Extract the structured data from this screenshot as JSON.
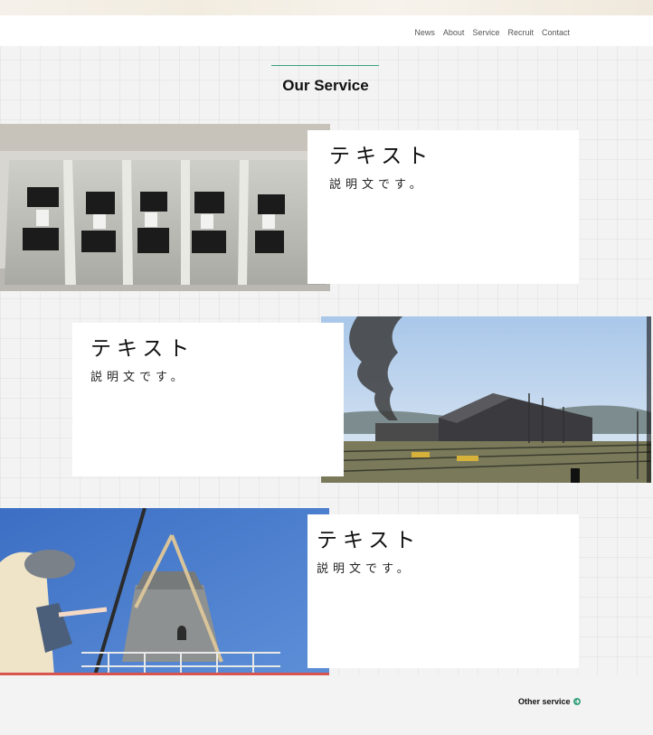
{
  "header": {
    "nav": [
      "News",
      "About",
      "Service",
      "Recruit",
      "Contact"
    ]
  },
  "section": {
    "title": "Our Service"
  },
  "services": [
    {
      "title": "テキスト",
      "description": "説明文です。",
      "image_icon": "electronics-tray-photo"
    },
    {
      "title": "テキスト",
      "description": "説明文です。",
      "image_icon": "steam-locomotive-photo"
    },
    {
      "title": "テキスト",
      "description": "説明文です。",
      "image_icon": "windmill-photo"
    }
  ],
  "footer": {
    "other_service": "Other service"
  },
  "colors": {
    "accent": "#3aa17e",
    "card": "#ffffff",
    "background": "#f3f3f3"
  }
}
